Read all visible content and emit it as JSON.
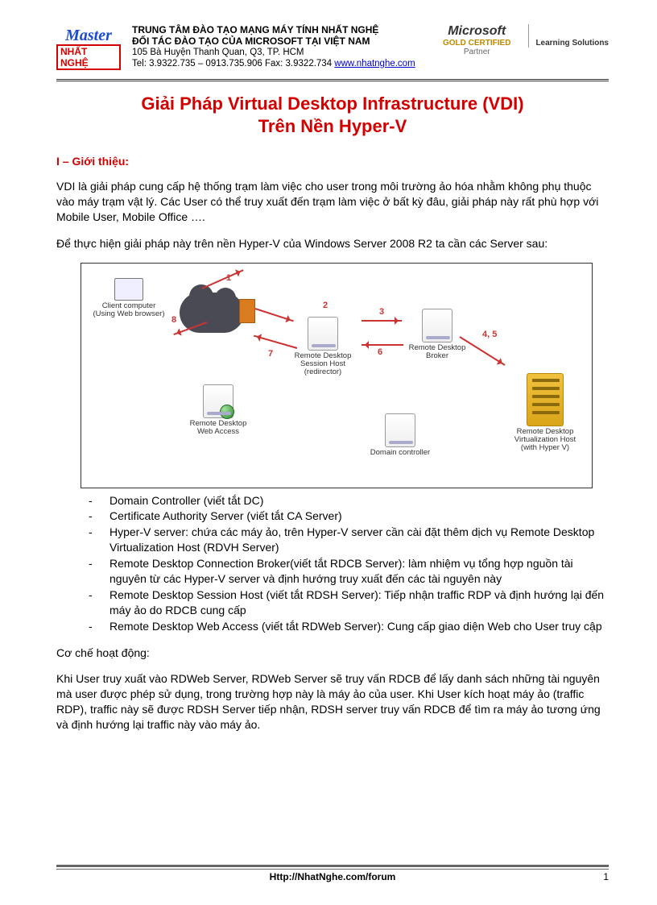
{
  "header": {
    "logo_top": "Master",
    "logo_bottom": "NHẤT NGHỆ",
    "line1": "TRUNG TÂM ĐÀO TẠO MẠNG MÁY TÍNH NHẤT NGHỆ",
    "line2": "ĐỐI TÁC ĐÀO TẠO CỦA MICROSOFT TẠI VIỆT NAM",
    "line3": "105 Bà Huyện Thanh Quan, Q3, TP. HCM",
    "line4a": "Tel: 3.9322.735 – 0913.735.906 Fax: 3.9322.734   ",
    "line4_link": "www.nhatnghe.com",
    "ms_logo": "Microsoft",
    "gold": "GOLD CERTIFIED",
    "partner": "Partner",
    "learning": "Learning Solutions"
  },
  "title_l1": "Giải Pháp Virtual Desktop Infrastructure (VDI)",
  "title_l2": "Trên Nền Hyper-V",
  "section1": "I – Giới thiệu:",
  "para1": "VDI là giải pháp cung cấp hệ thống trạm làm việc cho user trong môi trường ảo hóa nhằm không phụ thuộc vào máy trạm vật lý. Các User có thể truy xuất đến trạm làm việc ở bất kỳ đâu, giải pháp này rất phù hợp với Mobile User, Mobile Office ….",
  "para2": "Để thực hiện giải pháp này trên nền Hyper-V của Windows Server 2008 R2 ta cần các Server sau:",
  "diagram": {
    "client": "Client computer\n(Using Web browser)",
    "rdwa": "Remote Desktop\nWeb Access",
    "rdsh": "Remote Desktop\nSession Host\n(redirector)",
    "rdcb": "Remote Desktop\nBroker",
    "dc": "Domain controller",
    "rdvh": "Remote Desktop\nVirtualization Host\n(with Hyper V)",
    "n1": "1",
    "n2": "2",
    "n3": "3",
    "n45": "4, 5",
    "n6": "6",
    "n7": "7",
    "n8": "8"
  },
  "bullets": [
    "Domain Controller (viết tắt DC)",
    "Certificate Authority Server (viết tắt CA Server)",
    "Hyper-V server: chứa các máy ảo, trên Hyper-V server cần cài đặt thêm dịch vụ Remote Desktop Virtualization Host (RDVH Server)",
    "Remote Desktop Connection Broker(viết tắt RDCB Server): làm nhiệm vụ tổng hợp nguồn tài nguyên từ các Hyper-V server và định hướng truy xuất đến các tài nguyên này",
    "Remote Desktop Session Host (viết tắt RDSH Server): Tiếp nhận traffic RDP và định hướng lại đến máy ảo do RDCB cung cấp",
    "Remote Desktop Web Access (viết tắt RDWeb Server): Cung cấp giao diện Web cho User truy cập"
  ],
  "para3": "Cơ chế hoạt động:",
  "para4": "Khi User truy xuất vào RDWeb Server, RDWeb Server sẽ truy vấn RDCB để lấy danh sách những tài nguyên mà user được phép sử dụng, trong trường hợp này là máy ảo của user. Khi User kích hoạt máy ảo (traffic RDP), traffic này sẽ được RDSH Server tiếp nhận, RDSH server truy vấn RDCB để tìm ra máy ảo tương ứng và định hướng lại traffic này vào máy ảo.",
  "footer": {
    "link": "Http://NhatNghe.com/forum",
    "page": "1"
  }
}
